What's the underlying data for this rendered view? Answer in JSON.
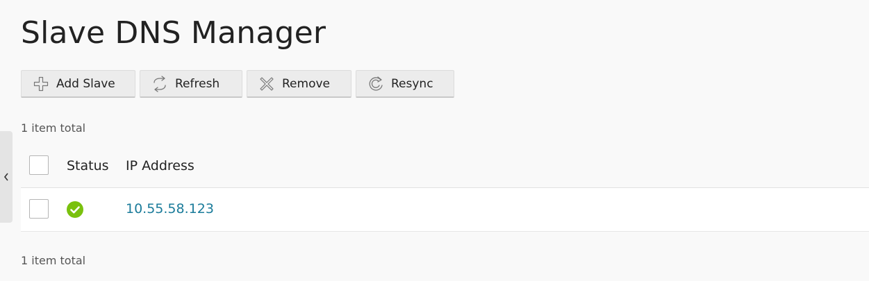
{
  "page": {
    "title": "Slave DNS Manager"
  },
  "toolbar": {
    "buttons": [
      {
        "label": "Add Slave",
        "icon": "plus-icon"
      },
      {
        "label": "Refresh",
        "icon": "refresh-icon"
      },
      {
        "label": "Remove",
        "icon": "remove-icon"
      },
      {
        "label": "Resync",
        "icon": "resync-icon"
      }
    ]
  },
  "list": {
    "count_top": "1 item total",
    "count_bottom": "1 item total",
    "columns": {
      "status": "Status",
      "ip_address": "IP Address"
    },
    "rows": [
      {
        "status": "ok",
        "status_color": "#7ac10e",
        "ip_address": "10.55.58.123"
      }
    ]
  },
  "colors": {
    "link": "#1a7b9a",
    "status_ok": "#7ac10e",
    "background": "#f9f9f9"
  }
}
